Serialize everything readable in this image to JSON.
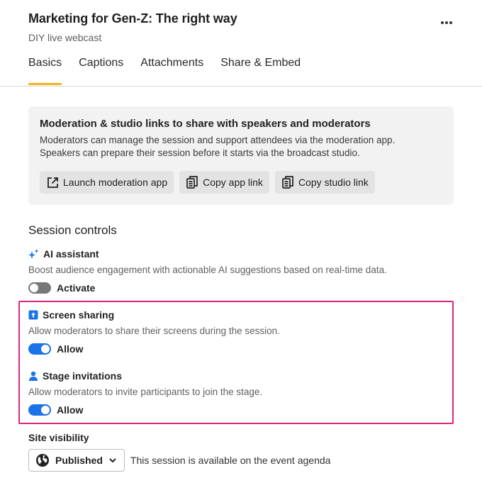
{
  "header": {
    "title": "Marketing for Gen-Z: The right way",
    "subtitle": "DIY live webcast"
  },
  "tabs": [
    {
      "label": "Basics",
      "active": true
    },
    {
      "label": "Captions",
      "active": false
    },
    {
      "label": "Attachments",
      "active": false
    },
    {
      "label": "Share & Embed",
      "active": false
    }
  ],
  "moderation": {
    "title": "Moderation & studio links to share with speakers and moderators",
    "desc_line1": "Moderators can manage the session and support attendees via the moderation app.",
    "desc_line2": "Speakers can prepare their session before it starts via the broadcast studio.",
    "launch_label": "Launch moderation app",
    "copy_app_label": "Copy app link",
    "copy_studio_label": "Copy studio link"
  },
  "session_controls": {
    "title": "Session controls",
    "ai": {
      "label": "AI assistant",
      "desc": "Boost audience engagement with actionable AI suggestions based on real-time data.",
      "toggle_label": "Activate",
      "enabled": false
    },
    "screen": {
      "label": "Screen sharing",
      "desc": "Allow moderators to share their screens during the session.",
      "toggle_label": "Allow",
      "enabled": true
    },
    "stage": {
      "label": "Stage invitations",
      "desc": "Allow moderators to invite participants to join the stage.",
      "toggle_label": "Allow",
      "enabled": true
    }
  },
  "visibility": {
    "label": "Site visibility",
    "selected": "Published",
    "desc": "This session is available on the event agenda"
  },
  "colors": {
    "accent_tab": "#f3b31a",
    "toggle_on": "#1a73e8",
    "toggle_off": "#777777",
    "highlight": "#e0257b"
  }
}
